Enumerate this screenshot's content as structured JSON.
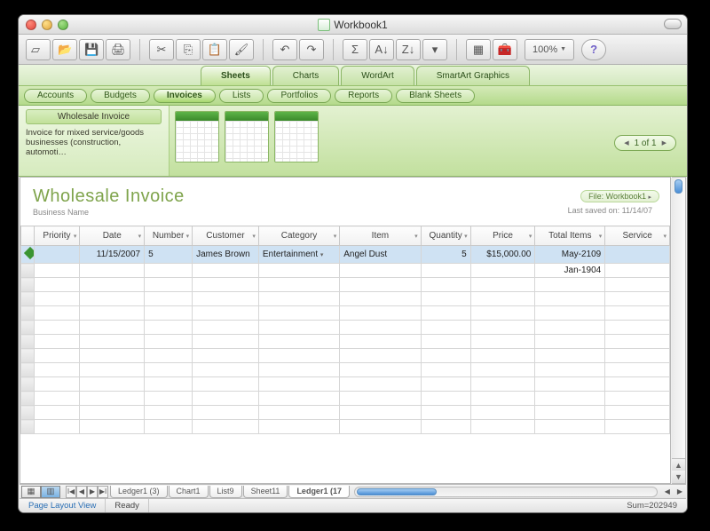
{
  "window": {
    "title": "Workbook1"
  },
  "toolbar": {
    "zoom": "100%"
  },
  "ribbon": {
    "tabs": [
      "Sheets",
      "Charts",
      "WordArt",
      "SmartArt Graphics"
    ],
    "active_tab": 0,
    "subtabs": [
      "Accounts",
      "Budgets",
      "Invoices",
      "Lists",
      "Portfolios",
      "Reports",
      "Blank Sheets"
    ],
    "active_subtab": 2
  },
  "gallery": {
    "title": "Wholesale Invoice",
    "desc": "Invoice for mixed service/goods businesses (construction, automoti…",
    "pager": "1 of 1"
  },
  "sheet": {
    "title": "Wholesale Invoice",
    "subtitle": "Business Name",
    "file_label": "File: Workbook1",
    "saved_label": "Last saved on: 11/14/07",
    "columns": [
      "Priority",
      "Date",
      "Number",
      "Customer",
      "Category",
      "Item",
      "Quantity",
      "Price",
      "Total Items",
      "Service"
    ],
    "rows": [
      {
        "priority": "",
        "date": "11/15/2007",
        "number": "5",
        "customer": "James Brown",
        "category": "Entertainment",
        "item": "Angel Dust",
        "quantity": "5",
        "price": "$15,000.00",
        "total_items": "May-2109",
        "service": ""
      },
      {
        "priority": "",
        "date": "",
        "number": "",
        "customer": "",
        "category": "",
        "item": "",
        "quantity": "",
        "price": "",
        "total_items": "Jan-1904",
        "service": ""
      }
    ]
  },
  "tabs": [
    "Ledger1 (3)",
    "Chart1",
    "List9",
    "Sheet11",
    "Ledger1 (17"
  ],
  "active_sheet_tab": 4,
  "status": {
    "view": "Page Layout View",
    "state": "Ready",
    "sum": "Sum=202949"
  }
}
